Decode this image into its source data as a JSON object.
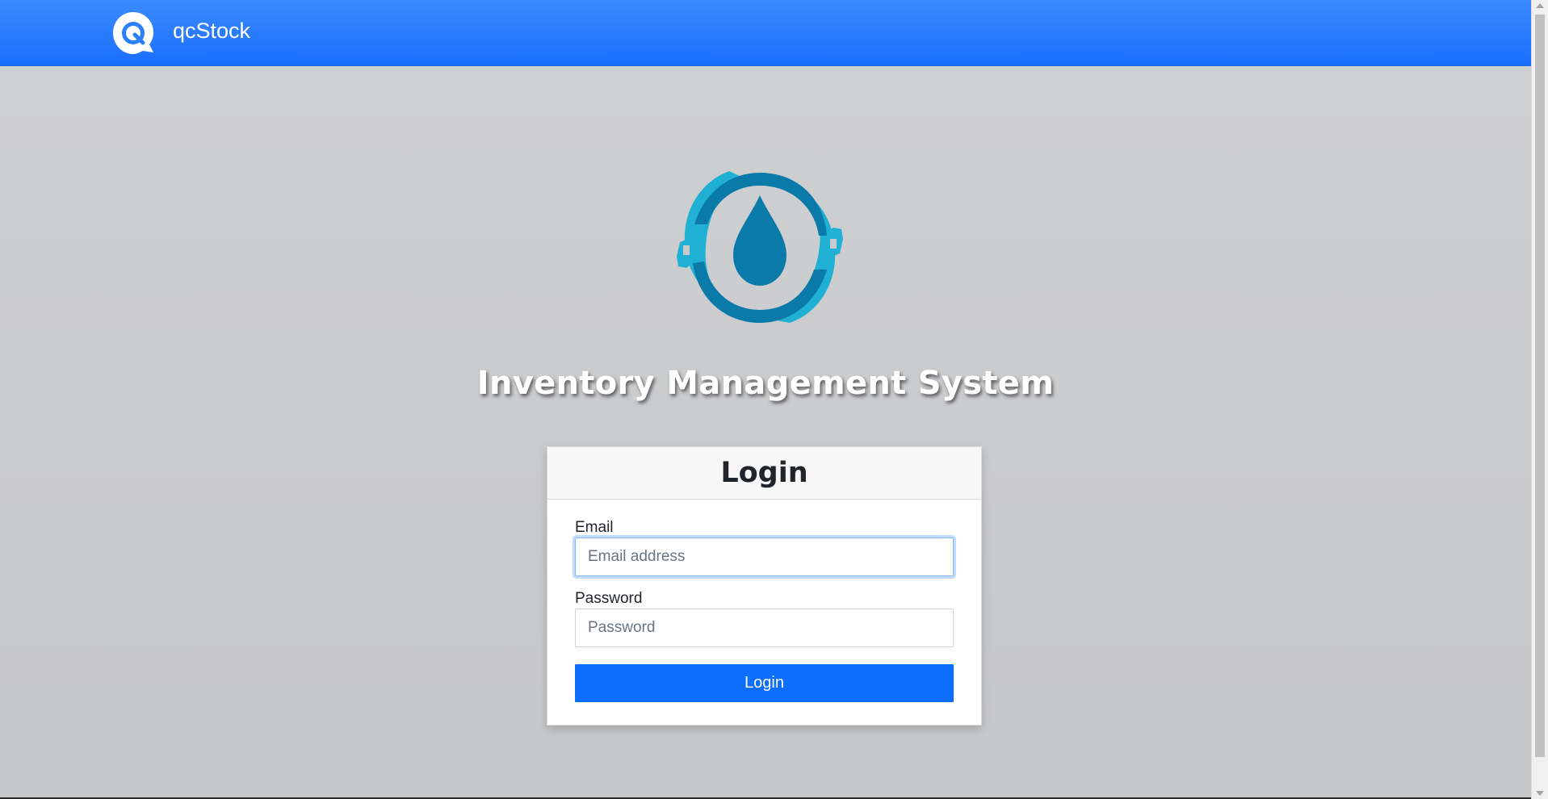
{
  "navbar": {
    "brand_name": "qcStock",
    "brand_icon": "q-logo-icon",
    "background": "#1a6dfd"
  },
  "hero": {
    "logo_icon": "water-drop-wrench-logo",
    "title": "Inventory Management System",
    "logo_colors": [
      "#0a7aa8",
      "#1fb0d3"
    ]
  },
  "login_card": {
    "title": "Login",
    "email_label": "Email",
    "email_placeholder": "Email address",
    "email_value": "",
    "password_label": "Password",
    "password_placeholder": "Password",
    "password_value": "",
    "submit_label": "Login",
    "accent": "#0d6efd"
  }
}
